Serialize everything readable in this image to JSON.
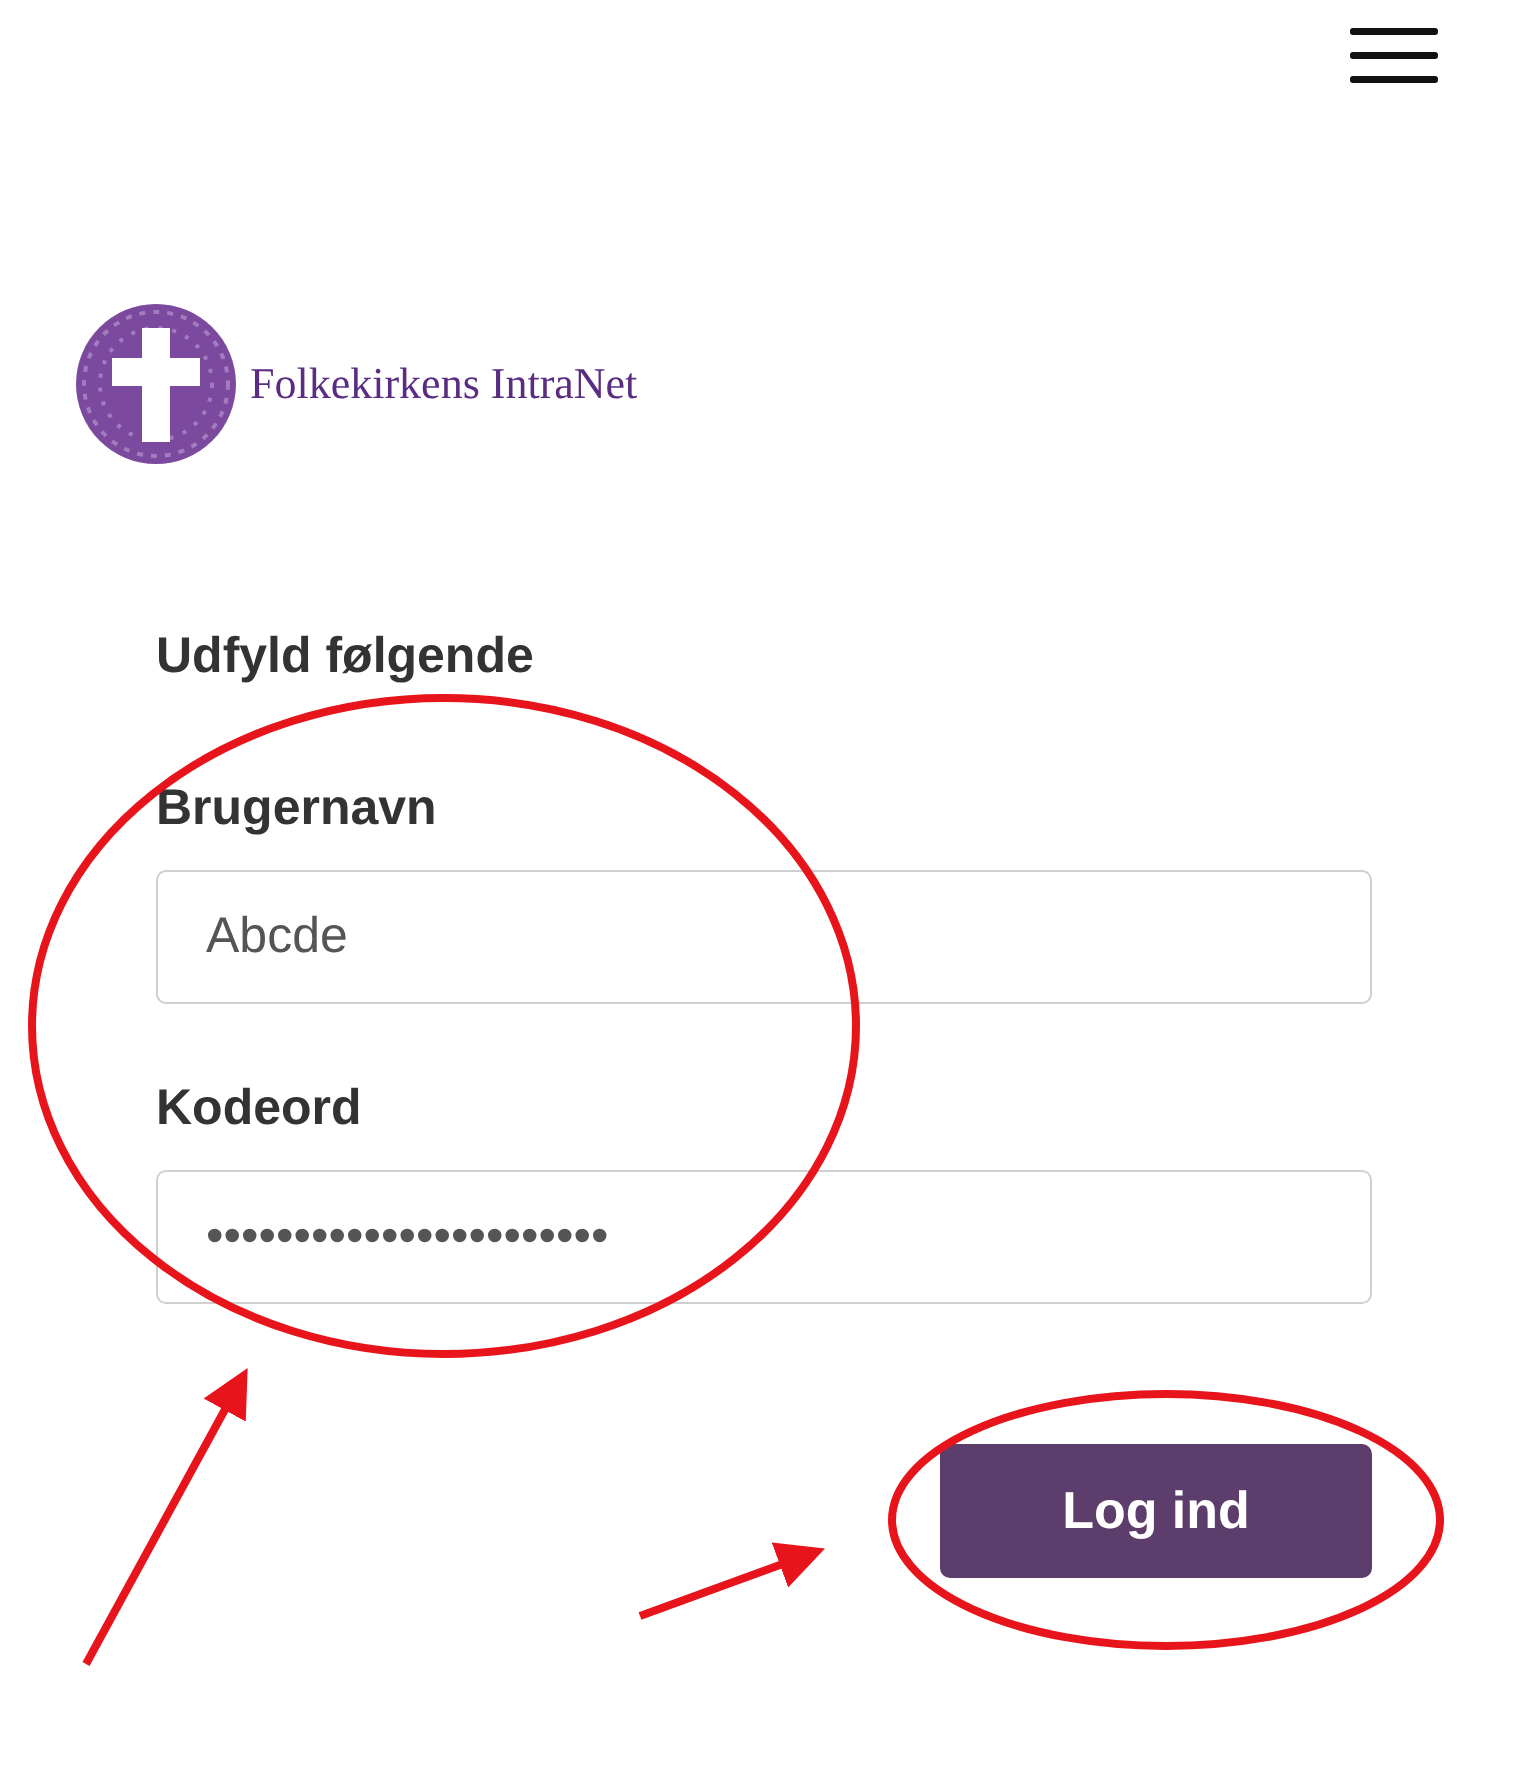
{
  "logo": {
    "title": "Folkekirkens IntraNet"
  },
  "form": {
    "heading": "Udfyld følgende",
    "fields": [
      {
        "label": "Brugernavn",
        "value": "Abcde"
      },
      {
        "label": "Kodeord",
        "value": "•••••••••••••••••••••••"
      }
    ],
    "submit": "Log ind"
  }
}
